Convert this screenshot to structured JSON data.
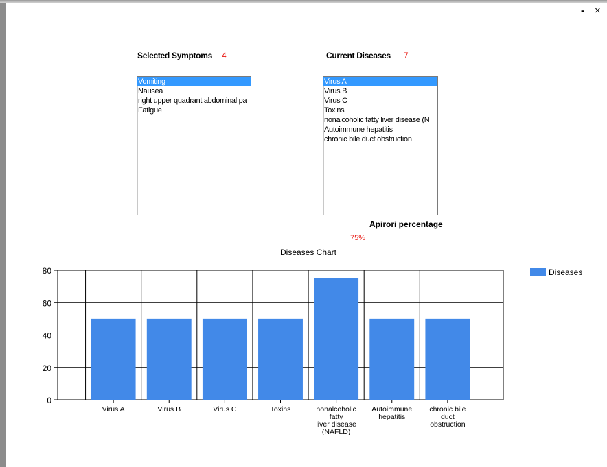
{
  "window": {
    "minimize_label": "-",
    "close_label": "×"
  },
  "symptoms": {
    "header": "Selected Symptoms",
    "count": "4",
    "items": [
      "Vomiting",
      "Nausea",
      "right upper quadrant abdominal pa",
      "Fatigue"
    ],
    "selected_index": 0
  },
  "diseases": {
    "header": "Current Diseases",
    "count": "7",
    "items": [
      "Virus A",
      "Virus B",
      "Virus C",
      "Toxins",
      "nonalcoholic fatty liver disease (N",
      "Autoimmune hepatitis",
      "chronic bile duct obstruction"
    ],
    "selected_index": 0
  },
  "apriori": {
    "label": "Apirori percentage",
    "value": "75%"
  },
  "colors": {
    "accent_red": "#e8140e",
    "selection_blue": "#3399ff",
    "bar_blue": "#4289e8"
  },
  "chart_data": {
    "type": "bar",
    "title": "Diseases Chart",
    "categories": [
      [
        "Virus A"
      ],
      [
        "Virus B"
      ],
      [
        "Virus C"
      ],
      [
        "Toxins"
      ],
      [
        "nonalcoholic",
        "fatty",
        "liver disease",
        "(NAFLD)"
      ],
      [
        "Autoimmune",
        "hepatitis"
      ],
      [
        "chronic bile",
        "duct",
        "obstruction"
      ]
    ],
    "series": [
      {
        "name": "Diseases",
        "values": [
          50,
          50,
          50,
          50,
          75,
          50,
          50
        ]
      }
    ],
    "yticks": [
      "0",
      "20",
      "40",
      "60",
      "80"
    ],
    "ylim": [
      0,
      80
    ],
    "grid": true,
    "legend_position": "top-right"
  }
}
